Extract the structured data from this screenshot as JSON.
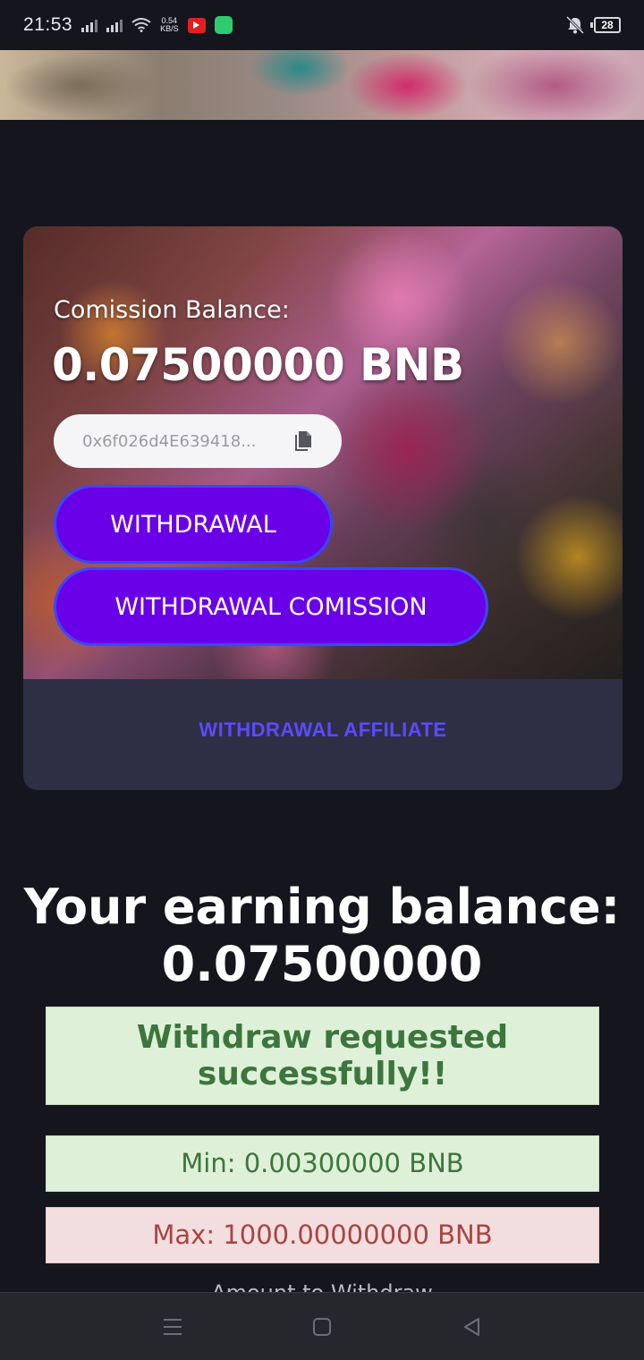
{
  "status_bar": {
    "time": "21:53",
    "speed_value": "0.54",
    "speed_unit": "KB/S",
    "battery": "28"
  },
  "card": {
    "commission_label": "Comission Balance:",
    "commission_value": "0.07500000 BNB",
    "wallet_address": "0x6f026d4E639418...",
    "withdrawal_label": "WITHDRAWAL",
    "withdrawal_commission_label": "WITHDRAWAL COMISSION",
    "affiliate_label": "WITHDRAWAL AFFILIATE"
  },
  "earnings": {
    "title": "Your earning balance:",
    "value": "0.07500000",
    "success_message": "Withdraw requested successfully!!",
    "min_label": "Min: 0.00300000 BNB",
    "max_label": "Max: 1000.00000000 BNB",
    "partial_label": "Amount to Withdraw"
  },
  "colors": {
    "button_bg": "#6a00e8",
    "button_border": "#3a46ff",
    "affiliate": "#5b4bff",
    "success_bg": "#dff0d8",
    "success_text": "#3c763d",
    "danger_bg": "#f2dede",
    "danger_text": "#a94442"
  },
  "icons": {
    "copy": "copy-icon",
    "nav_menu": "menu-icon",
    "nav_home": "home-icon",
    "nav_back": "back-icon"
  }
}
